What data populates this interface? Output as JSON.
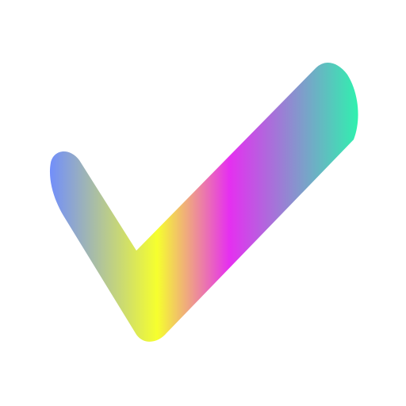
{
  "image": {
    "subject": "checkmark-icon",
    "background_color": "#ffffff",
    "gradient_colors": [
      "#6f8cff",
      "#f6ff2e",
      "#e52ff0",
      "#2cf5ad"
    ]
  }
}
